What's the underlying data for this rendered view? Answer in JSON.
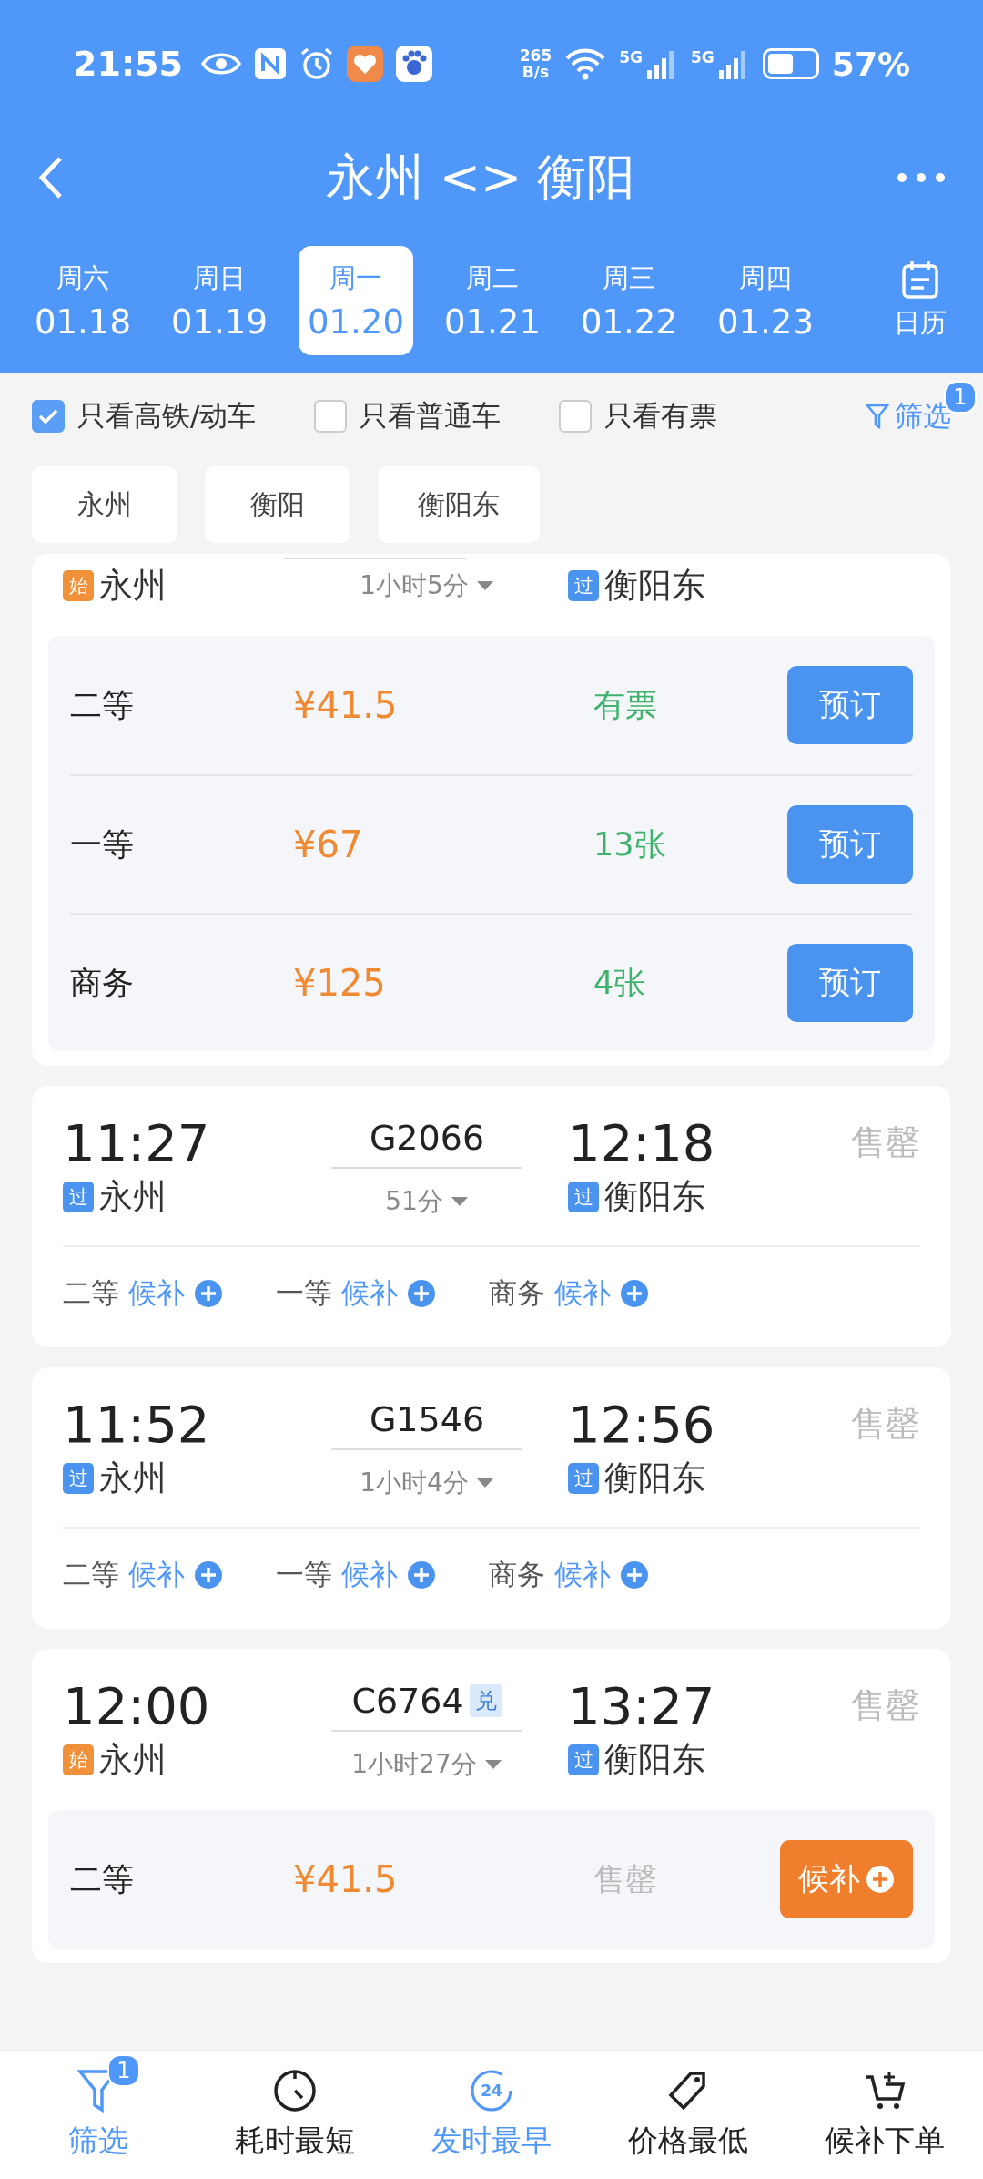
{
  "status_bar": {
    "time": "21:55",
    "speed_value": "265",
    "speed_unit": "B/s",
    "network_1": "5G",
    "network_2": "5G",
    "battery": "57%"
  },
  "header": {
    "title": "永州 <> 衡阳",
    "calendar_label": "日历"
  },
  "dates": [
    {
      "weekday": "周六",
      "date": "01.18",
      "selected": false
    },
    {
      "weekday": "周日",
      "date": "01.19",
      "selected": false
    },
    {
      "weekday": "周一",
      "date": "01.20",
      "selected": true
    },
    {
      "weekday": "周二",
      "date": "01.21",
      "selected": false
    },
    {
      "weekday": "周三",
      "date": "01.22",
      "selected": false
    },
    {
      "weekday": "周四",
      "date": "01.23",
      "selected": false
    }
  ],
  "filters": [
    {
      "label": "只看高铁/动车",
      "checked": true
    },
    {
      "label": "只看普通车",
      "checked": false
    },
    {
      "label": "只看有票",
      "checked": false
    }
  ],
  "filter_button": {
    "label": "筛选",
    "badge": "1"
  },
  "stations": [
    {
      "label": "永州"
    },
    {
      "label": "衡阳"
    },
    {
      "label": "衡阳东"
    }
  ],
  "trains": [
    {
      "kind": "clipped",
      "from": {
        "tag": "始",
        "kind": "origin",
        "name": "永州"
      },
      "duration": "1小时5分",
      "to": {
        "tag": "过",
        "kind": "passing",
        "name": "衡阳东"
      },
      "seats": [
        {
          "kind": "row",
          "class": "二等",
          "price": "¥41.5",
          "availability": "有票",
          "available": true,
          "action": "预订"
        },
        {
          "kind": "row",
          "class": "一等",
          "price": "¥67",
          "availability": "13张",
          "available": true,
          "action": "预订"
        },
        {
          "kind": "row",
          "class": "商务",
          "price": "¥125",
          "availability": "4张",
          "available": true,
          "action": "预订"
        }
      ]
    },
    {
      "kind": "full",
      "depart": "11:27",
      "train_no": "G2066",
      "arrive": "12:18",
      "status": "售罄",
      "from": {
        "tag": "过",
        "kind": "passing",
        "name": "永州"
      },
      "duration": "51分",
      "to": {
        "tag": "过",
        "kind": "passing",
        "name": "衡阳东"
      },
      "seats": [
        {
          "kind": "inline",
          "class": "二等",
          "action": "候补"
        },
        {
          "kind": "inline",
          "class": "一等",
          "action": "候补"
        },
        {
          "kind": "inline",
          "class": "商务",
          "action": "候补"
        }
      ]
    },
    {
      "kind": "full",
      "depart": "11:52",
      "train_no": "G1546",
      "arrive": "12:56",
      "status": "售罄",
      "from": {
        "tag": "过",
        "kind": "passing",
        "name": "永州"
      },
      "duration": "1小时4分",
      "to": {
        "tag": "过",
        "kind": "passing",
        "name": "衡阳东"
      },
      "seats": [
        {
          "kind": "inline",
          "class": "二等",
          "action": "候补"
        },
        {
          "kind": "inline",
          "class": "一等",
          "action": "候补"
        },
        {
          "kind": "inline",
          "class": "商务",
          "action": "候补"
        }
      ]
    },
    {
      "kind": "full",
      "depart": "12:00",
      "train_no": "C6764",
      "train_badge": "兑",
      "arrive": "13:27",
      "status": "售罄",
      "from": {
        "tag": "始",
        "kind": "origin",
        "name": "永州"
      },
      "duration": "1小时27分",
      "to": {
        "tag": "过",
        "kind": "passing",
        "name": "衡阳东"
      },
      "seats": [
        {
          "kind": "row",
          "class": "二等",
          "price": "¥41.5",
          "availability": "售罄",
          "available": false,
          "action": "候补"
        }
      ]
    }
  ],
  "bottom_nav": [
    {
      "kind": "filter",
      "label": "筛选",
      "highlighted": true,
      "badge": "1"
    },
    {
      "kind": "timer",
      "label": "耗时最短",
      "highlighted": false
    },
    {
      "kind": "clock",
      "label": "发时最早",
      "highlighted": true,
      "icon_text": "24"
    },
    {
      "kind": "tag",
      "label": "价格最低",
      "highlighted": false
    },
    {
      "kind": "cart",
      "label": "候补下单",
      "highlighted": false
    }
  ]
}
